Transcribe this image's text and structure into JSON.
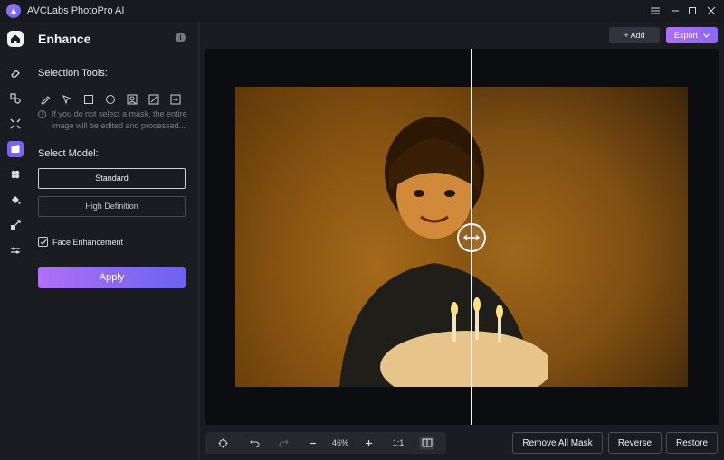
{
  "app": {
    "title": "AVCLabs PhotoPro AI"
  },
  "panel": {
    "title": "Enhance",
    "selection_tools_label": "Selection Tools:",
    "hint_text": "If you do not select a mask, the entire image will be edited and processed...",
    "select_model_label": "Select Model:",
    "models": [
      {
        "label": "Standard",
        "selected": true
      },
      {
        "label": "High Definition",
        "selected": false
      }
    ],
    "face_enhancement_label": "Face Enhancement",
    "face_enhancement_checked": true,
    "apply_label": "Apply"
  },
  "header_actions": {
    "add_label": "+ Add",
    "export_label": "Export"
  },
  "bottom_toolbar": {
    "zoom": "46%",
    "one_to_one": "1:1"
  },
  "actions": {
    "remove_all_mask": "Remove All Mask",
    "reverse": "Reverse",
    "restore": "Restore"
  },
  "colors": {
    "accent_start": "#b06ff5",
    "accent_end": "#6a63f0"
  }
}
